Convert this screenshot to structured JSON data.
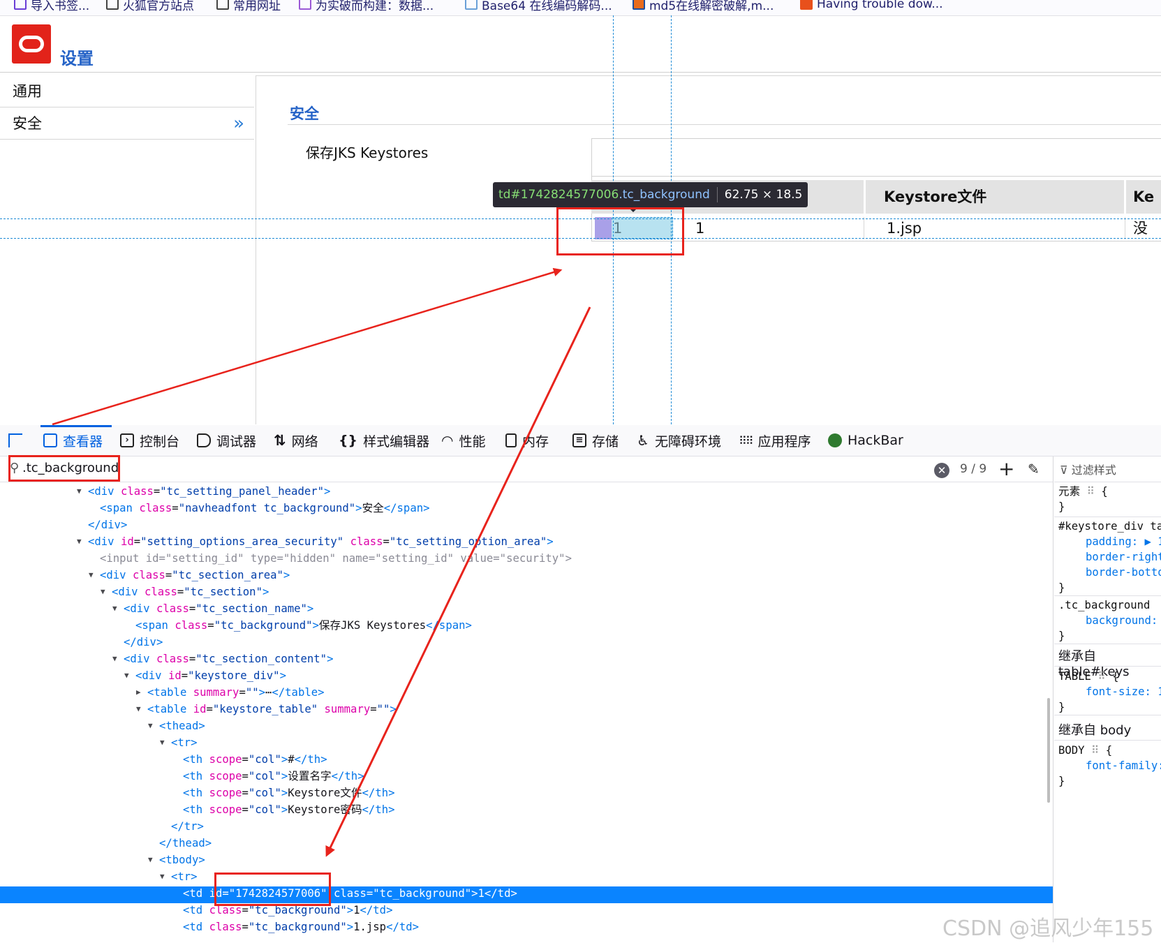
{
  "bookmarks": [
    "导入书签...",
    "火狐官方站点",
    "常用网址",
    "为实破而构建：数据...",
    "Base64 在线编码解码...",
    "md5在线解密破解,m...",
    "Having trouble dow..."
  ],
  "app": {
    "title": "设置"
  },
  "sidebar": {
    "items": [
      {
        "label": "通用"
      },
      {
        "label": "安全",
        "chevron": "»"
      }
    ]
  },
  "section": {
    "title": "安全",
    "name": "保存JKS Keystores"
  },
  "keystore_table": {
    "headers": [
      "Keystore文件",
      "Ke"
    ],
    "row": [
      "1",
      "1",
      "1.jsp",
      "没"
    ]
  },
  "inspector_tooltip": {
    "selector": "td#1742824577006",
    "class": ".tc_background",
    "size": "62.75 × 18.5"
  },
  "devtools": {
    "tabs": [
      {
        "label": "查看器",
        "icon": "inspector-icon"
      },
      {
        "label": "控制台",
        "icon": "console-icon"
      },
      {
        "label": "调试器",
        "icon": "debugger-icon"
      },
      {
        "label": "网络",
        "icon": "network-icon"
      },
      {
        "label": "样式编辑器",
        "icon": "style-editor-icon"
      },
      {
        "label": "性能",
        "icon": "performance-icon"
      },
      {
        "label": "内存",
        "icon": "memory-icon"
      },
      {
        "label": "存储",
        "icon": "storage-icon"
      },
      {
        "label": "无障碍环境",
        "icon": "accessibility-icon"
      },
      {
        "label": "应用程序",
        "icon": "application-icon"
      },
      {
        "label": "HackBar",
        "icon": "hackbar-icon"
      }
    ],
    "search": {
      "value": ".tc_background",
      "count": "9 / 9"
    },
    "markup": [
      {
        "i": 0,
        "arrow": "▼",
        "parts": [
          [
            "tag",
            "<div "
          ],
          [
            "att",
            "class"
          ],
          [
            "txt",
            "="
          ],
          [
            "val",
            "\"tc_setting_panel_header\""
          ],
          [
            "tag",
            ">"
          ]
        ]
      },
      {
        "i": 1,
        "parts": [
          [
            "tag",
            "<span "
          ],
          [
            "att",
            "class"
          ],
          [
            "txt",
            "="
          ],
          [
            "val",
            "\"navheadfont tc_background\""
          ],
          [
            "tag",
            ">"
          ],
          [
            "txt",
            "安全"
          ],
          [
            "tag",
            "</span>"
          ]
        ]
      },
      {
        "i": 0,
        "parts": [
          [
            "tag",
            "</div>"
          ]
        ]
      },
      {
        "i": 0,
        "arrow": "▼",
        "parts": [
          [
            "tag",
            "<div "
          ],
          [
            "att",
            "id"
          ],
          [
            "txt",
            "="
          ],
          [
            "val",
            "\"setting_options_area_security\""
          ],
          [
            "txt",
            " "
          ],
          [
            "att",
            "class"
          ],
          [
            "txt",
            "="
          ],
          [
            "val",
            "\"tc_setting_option_area\""
          ],
          [
            "tag",
            ">"
          ]
        ]
      },
      {
        "i": 1,
        "dim": true,
        "parts": [
          [
            "dim",
            "<input id=\"setting_id\" type=\"hidden\" name=\"setting_id\" value=\"security\">"
          ]
        ]
      },
      {
        "i": 1,
        "arrow": "▼",
        "parts": [
          [
            "tag",
            "<div "
          ],
          [
            "att",
            "class"
          ],
          [
            "txt",
            "="
          ],
          [
            "val",
            "\"tc_section_area\""
          ],
          [
            "tag",
            ">"
          ]
        ]
      },
      {
        "i": 2,
        "arrow": "▼",
        "parts": [
          [
            "tag",
            "<div "
          ],
          [
            "att",
            "class"
          ],
          [
            "txt",
            "="
          ],
          [
            "val",
            "\"tc_section\""
          ],
          [
            "tag",
            ">"
          ]
        ]
      },
      {
        "i": 3,
        "arrow": "▼",
        "parts": [
          [
            "tag",
            "<div "
          ],
          [
            "att",
            "class"
          ],
          [
            "txt",
            "="
          ],
          [
            "val",
            "\"tc_section_name\""
          ],
          [
            "tag",
            ">"
          ]
        ]
      },
      {
        "i": 4,
        "parts": [
          [
            "tag",
            "<span "
          ],
          [
            "att",
            "class"
          ],
          [
            "txt",
            "="
          ],
          [
            "val",
            "\"tc_background\""
          ],
          [
            "tag",
            ">"
          ],
          [
            "txt",
            "保存JKS Keystores"
          ],
          [
            "tag",
            "</span>"
          ]
        ]
      },
      {
        "i": 3,
        "parts": [
          [
            "tag",
            "</div>"
          ]
        ]
      },
      {
        "i": 3,
        "arrow": "▼",
        "parts": [
          [
            "tag",
            "<div "
          ],
          [
            "att",
            "class"
          ],
          [
            "txt",
            "="
          ],
          [
            "val",
            "\"tc_section_content\""
          ],
          [
            "tag",
            ">"
          ]
        ]
      },
      {
        "i": 4,
        "arrow": "▼",
        "parts": [
          [
            "tag",
            "<div "
          ],
          [
            "att",
            "id"
          ],
          [
            "txt",
            "="
          ],
          [
            "val",
            "\"keystore_div\""
          ],
          [
            "tag",
            ">"
          ]
        ]
      },
      {
        "i": 5,
        "arrow": "▶",
        "parts": [
          [
            "tag",
            "<table "
          ],
          [
            "att",
            "summary"
          ],
          [
            "txt",
            "="
          ],
          [
            "val",
            "\"\""
          ],
          [
            "tag",
            ">"
          ],
          [
            "txt",
            "⋯"
          ],
          [
            "tag",
            "</table>"
          ]
        ]
      },
      {
        "i": 5,
        "arrow": "▼",
        "parts": [
          [
            "tag",
            "<table "
          ],
          [
            "att",
            "id"
          ],
          [
            "txt",
            "="
          ],
          [
            "val",
            "\"keystore_table\""
          ],
          [
            "txt",
            " "
          ],
          [
            "att",
            "summary"
          ],
          [
            "txt",
            "="
          ],
          [
            "val",
            "\"\""
          ],
          [
            "tag",
            ">"
          ]
        ]
      },
      {
        "i": 6,
        "arrow": "▼",
        "parts": [
          [
            "tag",
            "<thead>"
          ]
        ]
      },
      {
        "i": 7,
        "arrow": "▼",
        "parts": [
          [
            "tag",
            "<tr>"
          ]
        ]
      },
      {
        "i": 8,
        "parts": [
          [
            "tag",
            "<th "
          ],
          [
            "att",
            "scope"
          ],
          [
            "txt",
            "="
          ],
          [
            "val",
            "\"col\""
          ],
          [
            "tag",
            ">"
          ],
          [
            "txt",
            "#"
          ],
          [
            "tag",
            "</th>"
          ]
        ]
      },
      {
        "i": 8,
        "parts": [
          [
            "tag",
            "<th "
          ],
          [
            "att",
            "scope"
          ],
          [
            "txt",
            "="
          ],
          [
            "val",
            "\"col\""
          ],
          [
            "tag",
            ">"
          ],
          [
            "txt",
            "设置名字"
          ],
          [
            "tag",
            "</th>"
          ]
        ]
      },
      {
        "i": 8,
        "parts": [
          [
            "tag",
            "<th "
          ],
          [
            "att",
            "scope"
          ],
          [
            "txt",
            "="
          ],
          [
            "val",
            "\"col\""
          ],
          [
            "tag",
            ">"
          ],
          [
            "txt",
            "Keystore文件"
          ],
          [
            "tag",
            "</th>"
          ]
        ]
      },
      {
        "i": 8,
        "parts": [
          [
            "tag",
            "<th "
          ],
          [
            "att",
            "scope"
          ],
          [
            "txt",
            "="
          ],
          [
            "val",
            "\"col\""
          ],
          [
            "tag",
            ">"
          ],
          [
            "txt",
            "Keystore密码"
          ],
          [
            "tag",
            "</th>"
          ]
        ]
      },
      {
        "i": 7,
        "parts": [
          [
            "tag",
            "</tr>"
          ]
        ]
      },
      {
        "i": 6,
        "parts": [
          [
            "tag",
            "</thead>"
          ]
        ]
      },
      {
        "i": 6,
        "arrow": "▼",
        "parts": [
          [
            "tag",
            "<tbody>"
          ]
        ]
      },
      {
        "i": 7,
        "arrow": "▼",
        "parts": [
          [
            "tag",
            "<tr>"
          ]
        ]
      },
      {
        "i": 8,
        "selected": true,
        "parts": [
          [
            "tag",
            "<td "
          ],
          [
            "att",
            "id"
          ],
          [
            "txt",
            "="
          ],
          [
            "val",
            "\"1742824577006\""
          ],
          [
            "txt",
            " "
          ],
          [
            "att",
            "class"
          ],
          [
            "txt",
            "="
          ],
          [
            "val",
            "\"tc_background\""
          ],
          [
            "tag",
            ">"
          ],
          [
            "txt",
            "1"
          ],
          [
            "tag",
            "</td>"
          ]
        ]
      },
      {
        "i": 8,
        "parts": [
          [
            "tag",
            "<td "
          ],
          [
            "att",
            "class"
          ],
          [
            "txt",
            "="
          ],
          [
            "val",
            "\"tc_background\""
          ],
          [
            "tag",
            ">"
          ],
          [
            "txt",
            "1"
          ],
          [
            "tag",
            "</td>"
          ]
        ]
      },
      {
        "i": 8,
        "parts": [
          [
            "tag",
            "<td "
          ],
          [
            "att",
            "class"
          ],
          [
            "txt",
            "="
          ],
          [
            "val",
            "\"tc_background\""
          ],
          [
            "tag",
            ">"
          ],
          [
            "txt",
            "1.jsp"
          ],
          [
            "tag",
            "</td>"
          ]
        ]
      }
    ],
    "rules": {
      "filter_placeholder": "过滤样式",
      "element_selector": "元素",
      "rule1_selector": "#keystore_div ta",
      "rule1_props": [
        "padding: ▶ 1p",
        "border-right",
        "border-botto"
      ],
      "rule2_selector": ".tc_background",
      "rule2_props": [
        "background:"
      ],
      "inherit1": "继承自 table#keys",
      "inherit1_selector": "TABLE",
      "inherit1_props": [
        "font-size: 1"
      ],
      "inherit2": "继承自 body",
      "inherit2_selector": "BODY",
      "inherit2_props": [
        "font-family:"
      ]
    }
  },
  "watermark": "CSDN @追风少年155"
}
